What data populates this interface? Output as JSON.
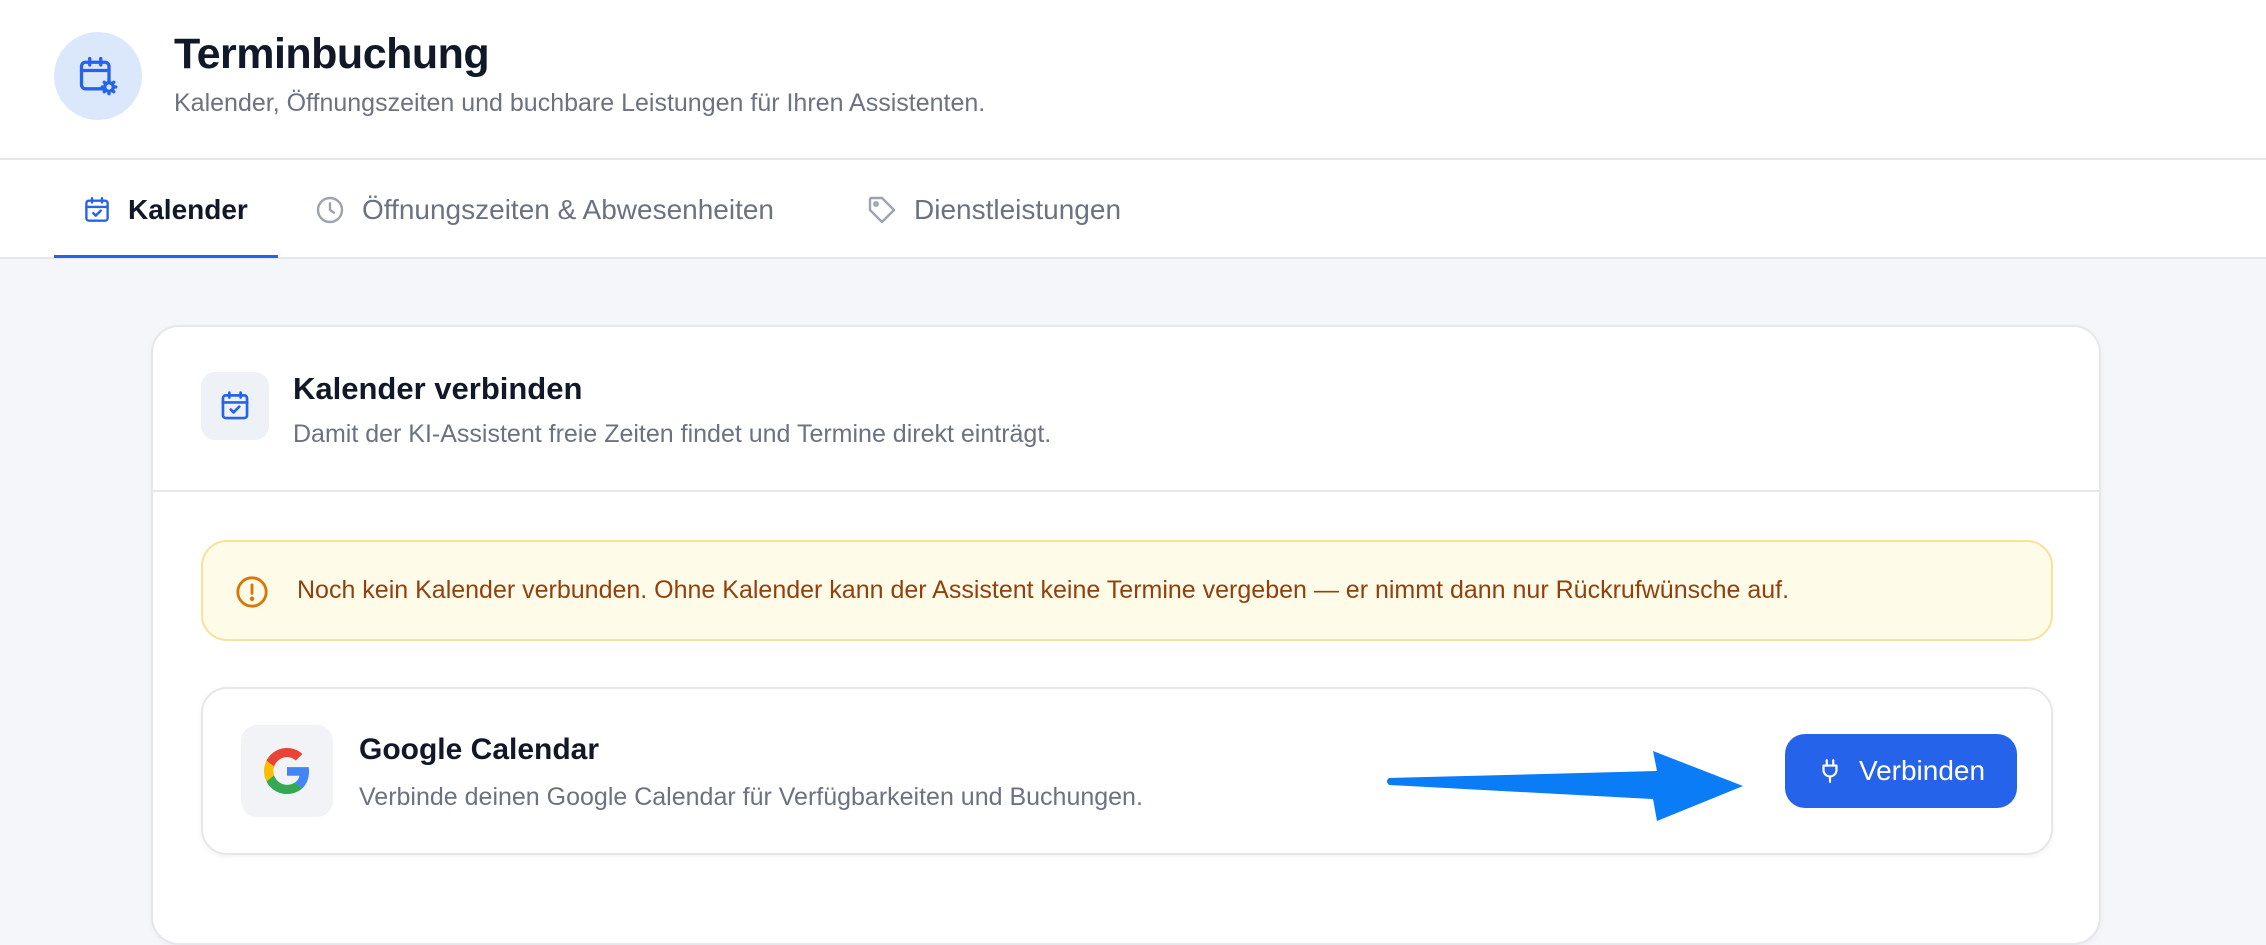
{
  "header": {
    "title": "Terminbuchung",
    "subtitle": "Kalender, Öffnungszeiten und buchbare Leistungen für Ihren Assistenten.",
    "icon": "calendar-gear-icon"
  },
  "tabs": [
    {
      "label": "Kalender",
      "icon": "calendar-check-icon",
      "active": true
    },
    {
      "label": "Öffnungszeiten & Abwesenheiten",
      "icon": "clock-icon",
      "active": false
    },
    {
      "label": "Dienstleistungen",
      "icon": "tag-icon",
      "active": false
    }
  ],
  "card": {
    "title": "Kalender verbinden",
    "subtitle": "Damit der KI-Assistent freie Zeiten findet und Termine direkt einträgt.",
    "icon": "calendar-check-icon"
  },
  "alert": {
    "text": "Noch kein Kalender verbunden. Ohne Kalender kann der Assistent keine Termine vergeben — er nimmt dann nur Rückrufwünsche auf.",
    "icon": "warning-circle-icon",
    "color": "#92400e",
    "background": "#fefbe8"
  },
  "provider": {
    "name": "Google Calendar",
    "description": "Verbinde deinen Google Calendar für Verfügbarkeiten und Buchungen.",
    "logo": "google-logo-icon",
    "button_label": "Verbinden",
    "button_icon": "plug-icon"
  },
  "colors": {
    "accent": "#2563eb",
    "arrow": "#0a7cf5"
  }
}
